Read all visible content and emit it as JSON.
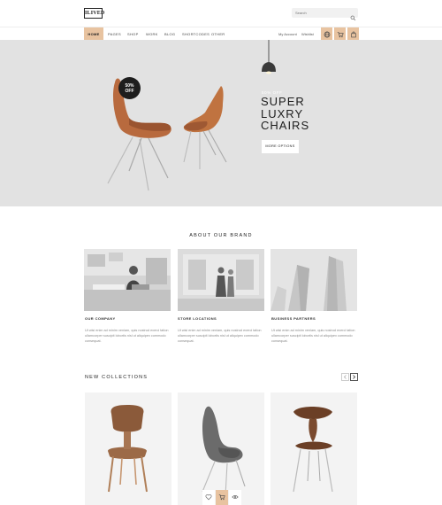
{
  "header": {
    "logo_text": "ILIVED",
    "search_placeholder": "Search"
  },
  "nav": {
    "items": [
      "HOME",
      "PAGES",
      "SHOP",
      "WORK",
      "BLOG",
      "SHORTCODES",
      "OTHER"
    ],
    "account": "My Account",
    "wishlist": "Wishlist"
  },
  "hero": {
    "badge_pct": "50%",
    "badge_word": "OFF",
    "kicker": "50% OFF",
    "title_line1": "SUPER",
    "title_line2": "LUXRY",
    "title_line3": "CHAIRS",
    "button": "MORE OPTIONS"
  },
  "about": {
    "title": "ABOUT OUR BRAND",
    "cards": [
      {
        "title": "OUR COMPANY",
        "text": "Ut wisi enim ad minim veniam, quis nostrud exerci tation ullamcorper suscipit lobortis nisl ut aliquipex commodo consequat."
      },
      {
        "title": "STORE LOCATIONS",
        "text": "Ut wisi enim ad minim veniam, quis nostrud exerci tation ullamcorper suscipit lobortis nisl ut aliquipex commodo consequat."
      },
      {
        "title": "BUSINESS PARTNERS",
        "text": "Ut wisi enim ad minim veniam, quis nostrud exerci tation ullamcorper suscipit lobortis nisl ut aliquipex commodo consequat."
      }
    ]
  },
  "collections": {
    "title": "NEW COLLECTIONS"
  },
  "colors": {
    "accent": "#e8c3a0",
    "hero_bg": "#e2e2e2",
    "dark": "#1d1d1d"
  }
}
